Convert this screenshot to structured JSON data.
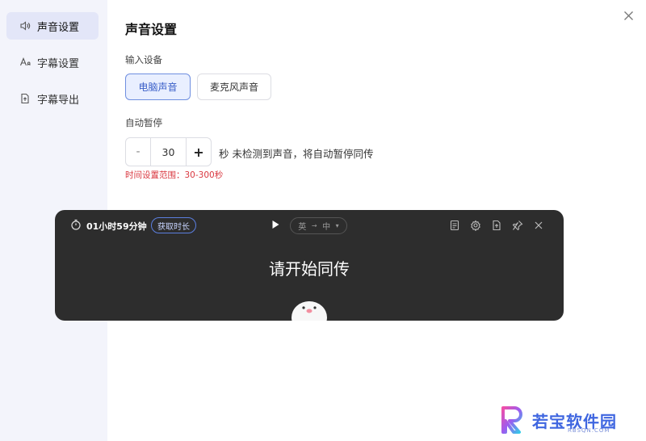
{
  "sidebar": {
    "items": [
      {
        "label": "声音设置",
        "icon": "speaker-icon",
        "active": true
      },
      {
        "label": "字幕设置",
        "icon": "font-size-icon",
        "active": false
      },
      {
        "label": "字幕导出",
        "icon": "file-export-icon",
        "active": false
      }
    ]
  },
  "main": {
    "title": "声音设置",
    "input_device": {
      "label": "输入设备",
      "options": [
        "电脑声音",
        "麦克风声音"
      ],
      "selected": "电脑声音"
    },
    "auto_pause": {
      "label": "自动暂停",
      "minus": "-",
      "value": "30",
      "plus": "+",
      "description": "秒 未检测到声音，将自动暂停同传",
      "hint": "时间设置范围：30-300秒"
    }
  },
  "player": {
    "timer": "01小时59分钟",
    "get_duration": "获取时长",
    "source_lang": "英",
    "target_lang": "中",
    "message": "请开始同传",
    "icons": [
      "document-icon",
      "settings-icon",
      "file-export-icon",
      "pin-icon",
      "close-icon"
    ]
  },
  "watermark": {
    "title": "若宝软件园",
    "subtitle": "RBSQN.COM"
  },
  "colors": {
    "accent": "#3a5fc8",
    "hint_red": "#d9363e",
    "player_bg": "#2d2d2d",
    "sidebar_bg": "#f3f4fb"
  }
}
